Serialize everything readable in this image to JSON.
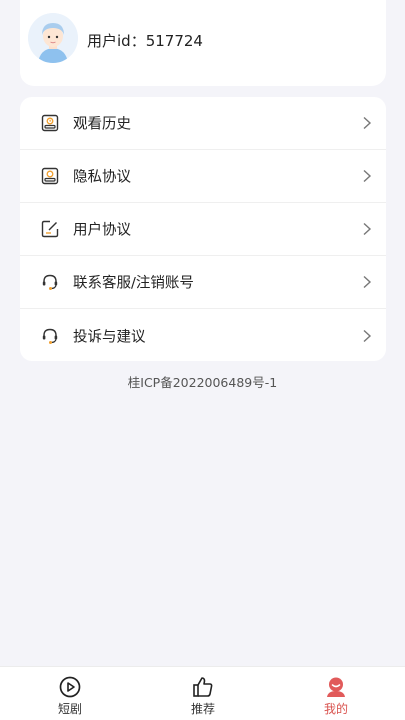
{
  "profile": {
    "user_id_text": "用户id：517724"
  },
  "menu": {
    "items": [
      {
        "label": "观看历史",
        "icon": "history-icon"
      },
      {
        "label": "隐私协议",
        "icon": "privacy-icon"
      },
      {
        "label": "用户协议",
        "icon": "agreement-icon"
      },
      {
        "label": "联系客服/注销账号",
        "icon": "customer-service-icon"
      },
      {
        "label": "投诉与建议",
        "icon": "feedback-icon"
      }
    ]
  },
  "icp_text": "桂ICP备2022006489号-1",
  "nav": {
    "items": [
      {
        "label": "短剧",
        "icon": "play-icon",
        "active": false
      },
      {
        "label": "推荐",
        "icon": "thumbs-up-icon",
        "active": false
      },
      {
        "label": "我的",
        "icon": "profile-icon",
        "active": true
      }
    ]
  },
  "colors": {
    "background": "#f4f4f9",
    "card": "#ffffff",
    "accent": "#d9534f",
    "icon_accent": "#f0a030"
  }
}
